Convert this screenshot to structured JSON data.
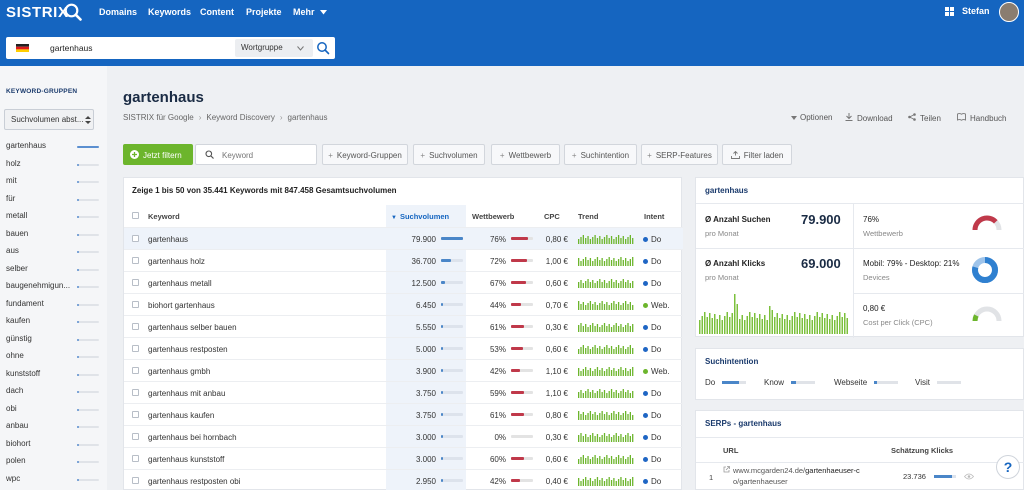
{
  "header": {
    "logo": "SISTRIX",
    "nav": [
      "Domains",
      "Keywords",
      "Content",
      "Projekte",
      "Mehr"
    ],
    "user": "Stefan"
  },
  "search": {
    "value": "gartenhaus",
    "mode": "Wortgruppe"
  },
  "sidebar": {
    "title": "KEYWORD-GRUPPEN",
    "sort_label": "Suchvolumen abst...",
    "items": [
      {
        "label": "gartenhaus",
        "share": 1.0
      },
      {
        "label": "holz",
        "share": 0.1
      },
      {
        "label": "mit",
        "share": 0.08
      },
      {
        "label": "für",
        "share": 0.07
      },
      {
        "label": "metall",
        "share": 0.06
      },
      {
        "label": "bauen",
        "share": 0.05
      },
      {
        "label": "aus",
        "share": 0.05
      },
      {
        "label": "selber",
        "share": 0.04
      },
      {
        "label": "baugenehmigun...",
        "share": 0.04
      },
      {
        "label": "fundament",
        "share": 0.04
      },
      {
        "label": "kaufen",
        "share": 0.04
      },
      {
        "label": "günstig",
        "share": 0.03
      },
      {
        "label": "ohne",
        "share": 0.03
      },
      {
        "label": "kunststoff",
        "share": 0.03
      },
      {
        "label": "dach",
        "share": 0.03
      },
      {
        "label": "obi",
        "share": 0.03
      },
      {
        "label": "anbau",
        "share": 0.03
      },
      {
        "label": "biohort",
        "share": 0.03
      },
      {
        "label": "polen",
        "share": 0.03
      },
      {
        "label": "wpc",
        "share": 0.02
      }
    ]
  },
  "page": {
    "title": "gartenhaus",
    "breadcrumb": [
      "SISTRIX für Google",
      "Keyword Discovery",
      "gartenhaus"
    ],
    "actions": [
      "Optionen",
      "Download",
      "Teilen",
      "Handbuch"
    ]
  },
  "toolbar": {
    "filter_button": "Jetzt filtern",
    "keyword_placeholder": "Keyword",
    "buttons": [
      "Keyword-Gruppen",
      "Suchvolumen",
      "Wettbewerb",
      "Suchintention",
      "SERP-Features",
      "Filter laden"
    ]
  },
  "table": {
    "summary": "Zeige 1 bis 50 von 35.441 Keywords mit 847.458 Gesamtsuchvolumen",
    "headers": [
      "Keyword",
      "Suchvolumen",
      "Wettbewerb",
      "CPC",
      "Trend",
      "Intent"
    ],
    "rows": [
      {
        "keyword": "gartenhaus",
        "volume": "79.900",
        "vol_share": 1.0,
        "competition": "76%",
        "comp": 0.76,
        "cpc": "0,80 €",
        "intent": "Do",
        "intent_color": "#1f66c4",
        "highlight": true
      },
      {
        "keyword": "gartenhaus holz",
        "volume": "36.700",
        "vol_share": 0.46,
        "competition": "72%",
        "comp": 0.72,
        "cpc": "1,00 €",
        "intent": "Do",
        "intent_color": "#1f66c4"
      },
      {
        "keyword": "gartenhaus metall",
        "volume": "12.500",
        "vol_share": 0.16,
        "competition": "67%",
        "comp": 0.67,
        "cpc": "0,60 €",
        "intent": "Do",
        "intent_color": "#1f66c4"
      },
      {
        "keyword": "biohort gartenhaus",
        "volume": "6.450",
        "vol_share": 0.08,
        "competition": "44%",
        "comp": 0.44,
        "cpc": "0,70 €",
        "intent": "Web.",
        "intent_color": "#6cb52c"
      },
      {
        "keyword": "gartenhaus selber bauen",
        "volume": "5.550",
        "vol_share": 0.07,
        "competition": "61%",
        "comp": 0.61,
        "cpc": "0,30 €",
        "intent": "Do",
        "intent_color": "#1f66c4"
      },
      {
        "keyword": "gartenhaus restposten",
        "volume": "5.000",
        "vol_share": 0.06,
        "competition": "53%",
        "comp": 0.53,
        "cpc": "0,60 €",
        "intent": "Do",
        "intent_color": "#1f66c4"
      },
      {
        "keyword": "gartenhaus gmbh",
        "volume": "3.900",
        "vol_share": 0.05,
        "competition": "42%",
        "comp": 0.42,
        "cpc": "1,10 €",
        "intent": "Web.",
        "intent_color": "#6cb52c"
      },
      {
        "keyword": "gartenhaus mit anbau",
        "volume": "3.750",
        "vol_share": 0.05,
        "competition": "59%",
        "comp": 0.59,
        "cpc": "1,10 €",
        "intent": "Do",
        "intent_color": "#1f66c4"
      },
      {
        "keyword": "gartenhaus kaufen",
        "volume": "3.750",
        "vol_share": 0.05,
        "competition": "61%",
        "comp": 0.61,
        "cpc": "0,80 €",
        "intent": "Do",
        "intent_color": "#1f66c4"
      },
      {
        "keyword": "gartenhaus bei hornbach",
        "volume": "3.000",
        "vol_share": 0.04,
        "competition": "0%",
        "comp": 0.0,
        "cpc": "0,30 €",
        "intent": "Do",
        "intent_color": "#1f66c4"
      },
      {
        "keyword": "gartenhaus kunststoff",
        "volume": "3.000",
        "vol_share": 0.04,
        "competition": "60%",
        "comp": 0.6,
        "cpc": "0,60 €",
        "intent": "Do",
        "intent_color": "#1f66c4"
      },
      {
        "keyword": "gartenhaus restposten obi",
        "volume": "2.950",
        "vol_share": 0.04,
        "competition": "42%",
        "comp": 0.42,
        "cpc": "0,40 €",
        "intent": "Do",
        "intent_color": "#1f66c4"
      }
    ]
  },
  "overview": {
    "title": "gartenhaus",
    "searches_label": "Ø Anzahl Suchen",
    "searches_value": "79.900",
    "searches_sub": "pro Monat",
    "clicks_label": "Ø Anzahl Klicks",
    "clicks_value": "69.000",
    "clicks_sub": "pro Monat",
    "competition_value": "76%",
    "competition_label": "Wettbewerb",
    "competition_share": 0.76,
    "devices_value": "Mobil: 79% - Desktop: 21%",
    "devices_label": "Devices",
    "mobile_share": 0.79,
    "cpc_value": "0,80 €",
    "cpc_label": "Cost per Click (CPC)",
    "cpc_share": 0.15
  },
  "intent_card": {
    "title": "Suchintention",
    "items": [
      {
        "label": "Do",
        "share": 0.7
      },
      {
        "label": "Know",
        "share": 0.2
      },
      {
        "label": "Webseite",
        "share": 0.1
      },
      {
        "label": "Visit",
        "share": 0.0
      }
    ]
  },
  "serps": {
    "title": "SERPs - gartenhaus",
    "col_url": "URL",
    "col_clicks": "Schätzung Klicks",
    "rows": [
      {
        "pos": "1",
        "url_prefix": "www.mcgarden24.de/",
        "url_bold": "gartenhaeuser-c",
        "url_line2": "o/gartenhaeuser",
        "clicks": "23.736",
        "share": 0.8
      }
    ]
  },
  "colors": {
    "brand": "#1565c0",
    "green": "#6cb52c",
    "red": "#c0394a"
  }
}
